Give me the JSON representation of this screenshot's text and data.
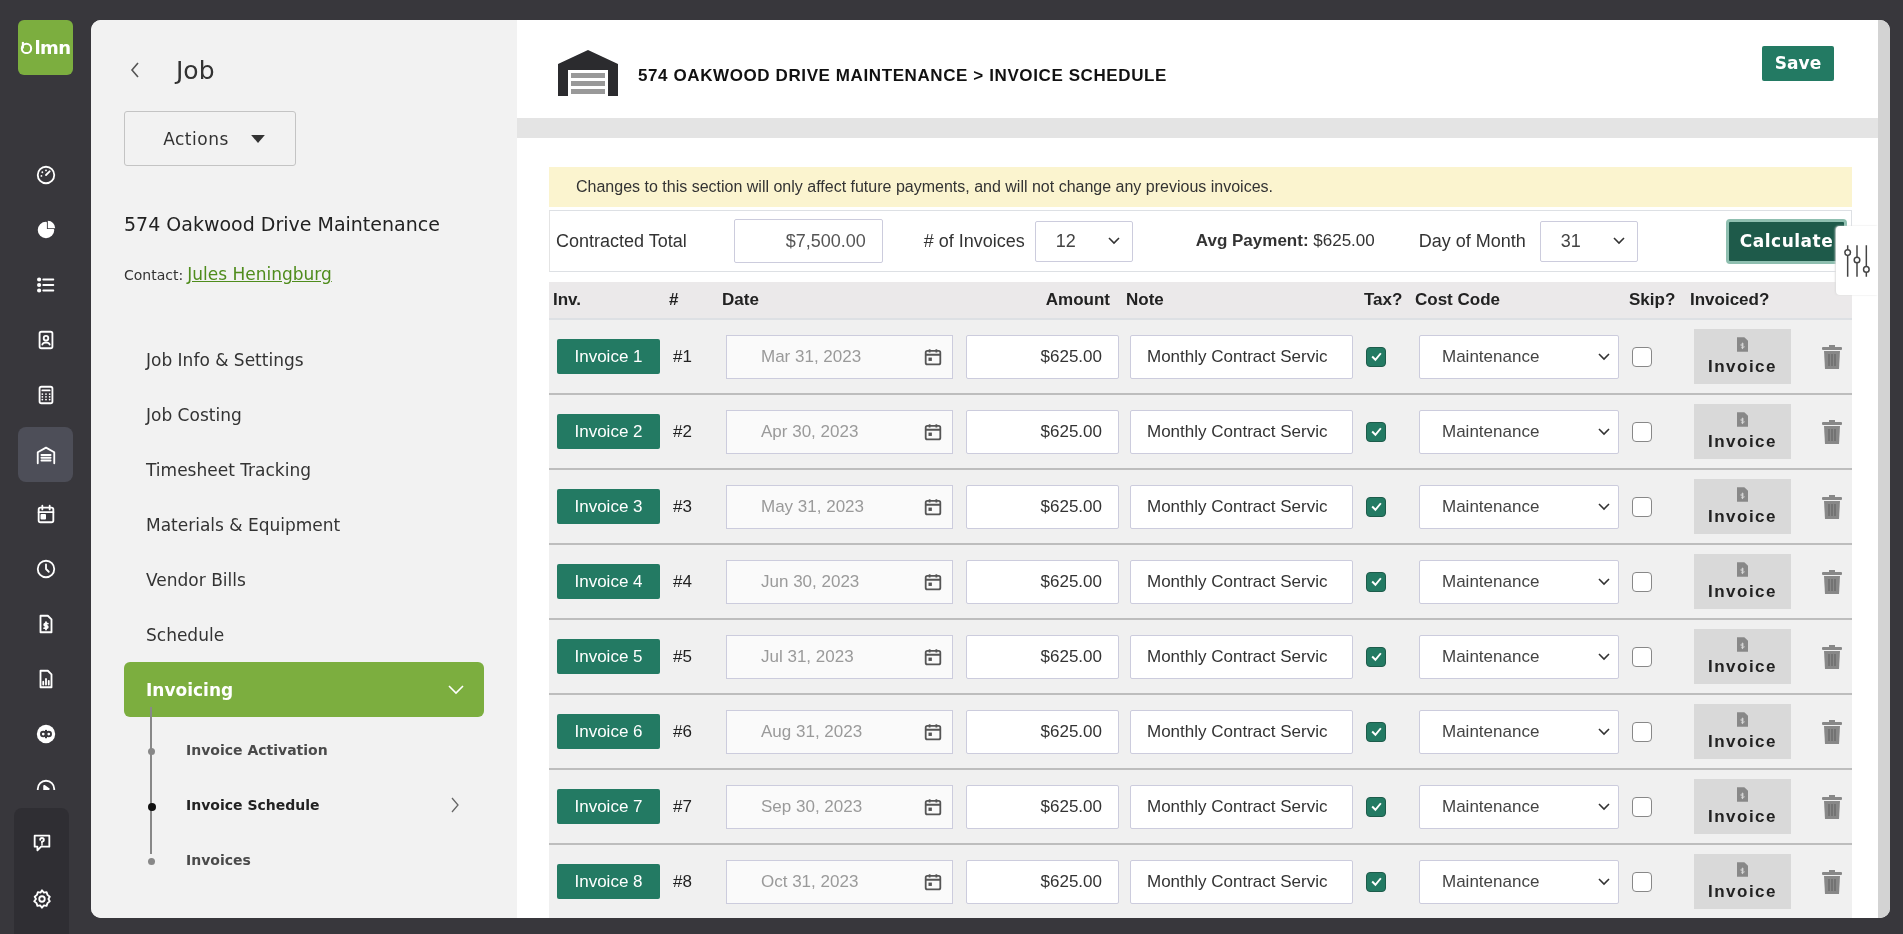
{
  "logo": {
    "text": "lmn"
  },
  "rail": {
    "items": [
      {
        "kind": "gauge",
        "selected": false
      },
      {
        "kind": "pie",
        "selected": false
      },
      {
        "kind": "list",
        "selected": false
      },
      {
        "kind": "contact",
        "selected": false
      },
      {
        "kind": "calculator",
        "selected": false
      },
      {
        "kind": "garage",
        "selected": true
      },
      {
        "kind": "calendar",
        "selected": false
      },
      {
        "kind": "clock",
        "selected": false
      },
      {
        "kind": "invoice",
        "selected": false
      },
      {
        "kind": "report",
        "selected": false
      },
      {
        "kind": "rings",
        "selected": false
      },
      {
        "kind": "play",
        "selected": false
      }
    ],
    "bottom": [
      {
        "kind": "help",
        "selected": false
      },
      {
        "kind": "settings",
        "selected": false
      }
    ]
  },
  "sidebar": {
    "title": "Job",
    "actions": "Actions",
    "job_name": "574 Oakwood Drive Maintenance",
    "contact_label": "Contact:",
    "contact_name": "Jules Heningburg",
    "nav": [
      {
        "label": "Job Info & Settings",
        "selected": false
      },
      {
        "label": "Job Costing",
        "selected": false
      },
      {
        "label": "Timesheet Tracking",
        "selected": false
      },
      {
        "label": "Materials & Equipment",
        "selected": false
      },
      {
        "label": "Vendor Bills",
        "selected": false
      },
      {
        "label": "Schedule",
        "selected": false
      },
      {
        "label": "Invoicing",
        "selected": true,
        "expanded": true,
        "children": [
          {
            "label": "Invoice Activation",
            "selected": false
          },
          {
            "label": "Invoice Schedule",
            "selected": true
          },
          {
            "label": "Invoices",
            "selected": false
          }
        ]
      }
    ]
  },
  "header": {
    "breadcrumb": "574 OAKWOOD DRIVE MAINTENANCE > INVOICE SCHEDULE",
    "save": "Save"
  },
  "notice": "Changes to this section will only affect future payments, and will not change any previous invoices.",
  "controls": {
    "contracted_total_label": "Contracted Total",
    "contracted_total": "$7,500.00",
    "invoices_label": "# of Invoices",
    "invoices": "12",
    "avg_label": "Avg Payment:",
    "avg_value": "$625.00",
    "day_label": "Day of Month",
    "day": "31",
    "calculate": "Calculate"
  },
  "table": {
    "columns": [
      "Inv.",
      "#",
      "Date",
      "Amount",
      "Note",
      "Tax?",
      "Cost Code",
      "Skip?",
      "Invoiced?"
    ],
    "rows": [
      {
        "invoice": "Invoice 1",
        "number": "#1",
        "date": "Mar 31, 2023",
        "amount": "$625.00",
        "note": "Monthly Contract Servic",
        "tax": true,
        "cost_code": "Maintenance",
        "skip": false,
        "invoiced": "Invoice"
      },
      {
        "invoice": "Invoice 2",
        "number": "#2",
        "date": "Apr 30, 2023",
        "amount": "$625.00",
        "note": "Monthly Contract Servic",
        "tax": true,
        "cost_code": "Maintenance",
        "skip": false,
        "invoiced": "Invoice"
      },
      {
        "invoice": "Invoice 3",
        "number": "#3",
        "date": "May 31, 2023",
        "amount": "$625.00",
        "note": "Monthly Contract Servic",
        "tax": true,
        "cost_code": "Maintenance",
        "skip": false,
        "invoiced": "Invoice"
      },
      {
        "invoice": "Invoice 4",
        "number": "#4",
        "date": "Jun 30, 2023",
        "amount": "$625.00",
        "note": "Monthly Contract Servic",
        "tax": true,
        "cost_code": "Maintenance",
        "skip": false,
        "invoiced": "Invoice"
      },
      {
        "invoice": "Invoice 5",
        "number": "#5",
        "date": "Jul 31, 2023",
        "amount": "$625.00",
        "note": "Monthly Contract Servic",
        "tax": true,
        "cost_code": "Maintenance",
        "skip": false,
        "invoiced": "Invoice"
      },
      {
        "invoice": "Invoice 6",
        "number": "#6",
        "date": "Aug 31, 2023",
        "amount": "$625.00",
        "note": "Monthly Contract Servic",
        "tax": true,
        "cost_code": "Maintenance",
        "skip": false,
        "invoiced": "Invoice"
      },
      {
        "invoice": "Invoice 7",
        "number": "#7",
        "date": "Sep 30, 2023",
        "amount": "$625.00",
        "note": "Monthly Contract Servic",
        "tax": true,
        "cost_code": "Maintenance",
        "skip": false,
        "invoiced": "Invoice"
      },
      {
        "invoice": "Invoice 8",
        "number": "#8",
        "date": "Oct 31, 2023",
        "amount": "$625.00",
        "note": "Monthly Contract Servic",
        "tax": true,
        "cost_code": "Maintenance",
        "skip": false,
        "invoiced": "Invoice"
      }
    ]
  }
}
